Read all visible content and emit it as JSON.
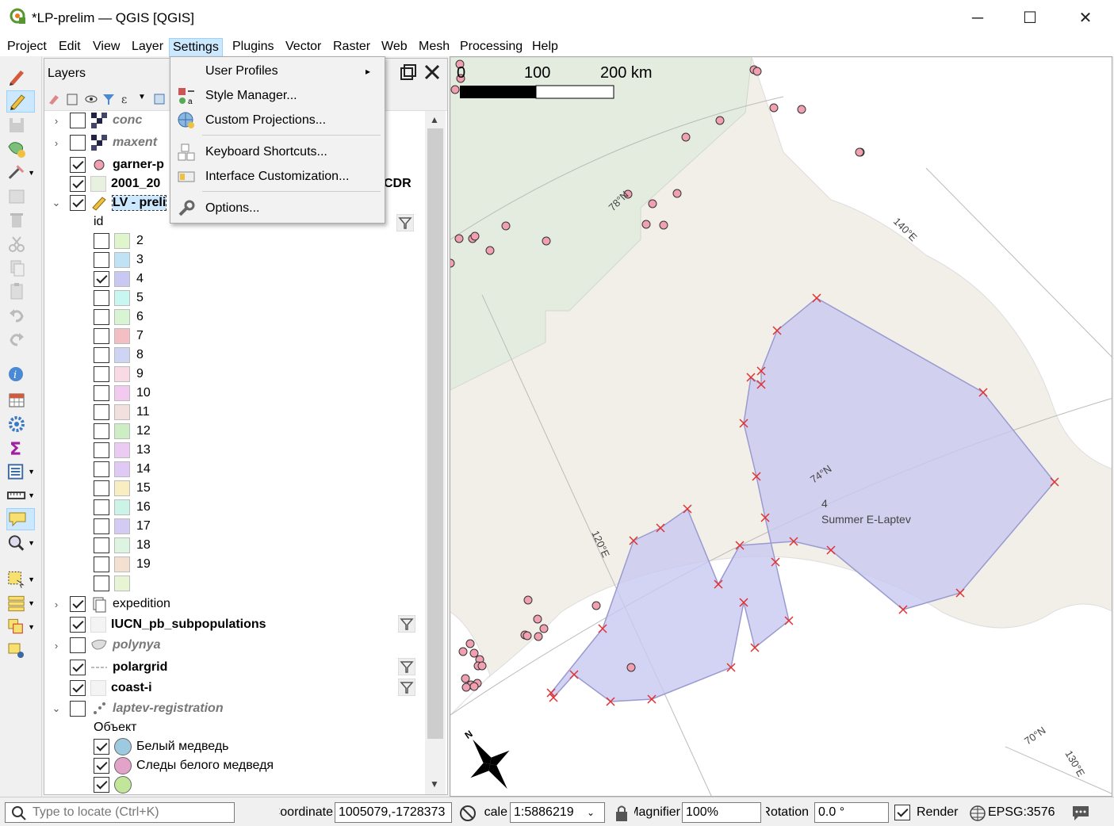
{
  "window": {
    "title": "*LP-prelim — QGIS [QGIS]",
    "minimize": "─",
    "maximize": "☐",
    "close": "✕"
  },
  "menu": [
    "Project",
    "Edit",
    "View",
    "Layer",
    "Settings",
    "Plugins",
    "Vector",
    "Raster",
    "Web",
    "Mesh",
    "Processing",
    "Help"
  ],
  "settings_menu": {
    "items": [
      "User Profiles",
      "Style Manager...",
      "Custom Projections...",
      "Keyboard Shortcuts...",
      "Interface Customization...",
      "Options..."
    ],
    "submenu_arrow": "▸"
  },
  "layers_panel": {
    "title": "Layers",
    "layers": [
      {
        "name": "conc",
        "checked": false,
        "style": "italic"
      },
      {
        "name": "maxent",
        "checked": false,
        "style": "italic"
      },
      {
        "name": "garner-p",
        "checked": true,
        "style": "bold"
      },
      {
        "name": "2001_20",
        "suffix": "CDR",
        "checked": true,
        "style": "bold"
      },
      {
        "name": "LV - preli",
        "checked": true,
        "style": "bold",
        "selected": true
      }
    ],
    "field_label": "id",
    "classes": [
      {
        "label": "2",
        "checked": false,
        "color": "#dff5cc"
      },
      {
        "label": "3",
        "checked": false,
        "color": "#bfe3f5"
      },
      {
        "label": "4",
        "checked": true,
        "color": "#c9c8f2"
      },
      {
        "label": "5",
        "checked": false,
        "color": "#c8f7f2"
      },
      {
        "label": "6",
        "checked": false,
        "color": "#d7f4d3"
      },
      {
        "label": "7",
        "checked": false,
        "color": "#f4bfc4"
      },
      {
        "label": "8",
        "checked": false,
        "color": "#cdd4f4"
      },
      {
        "label": "9",
        "checked": false,
        "color": "#f8d9e4"
      },
      {
        "label": "10",
        "checked": false,
        "color": "#f2c9ef"
      },
      {
        "label": "11",
        "checked": false,
        "color": "#f2e0dd"
      },
      {
        "label": "12",
        "checked": false,
        "color": "#cdedc4"
      },
      {
        "label": "13",
        "checked": false,
        "color": "#ebcbf2"
      },
      {
        "label": "14",
        "checked": false,
        "color": "#e0c9f4"
      },
      {
        "label": "15",
        "checked": false,
        "color": "#f8eec2"
      },
      {
        "label": "16",
        "checked": false,
        "color": "#cbf4e6"
      },
      {
        "label": "17",
        "checked": false,
        "color": "#d4cbf4"
      },
      {
        "label": "18",
        "checked": false,
        "color": "#dcf4e0"
      },
      {
        "label": "19",
        "checked": false,
        "color": "#f4e0d0"
      },
      {
        "label": "",
        "checked": false,
        "color": "#e8f5d4"
      }
    ],
    "lower_layers": [
      {
        "name": "expedition",
        "checked": true,
        "style": "normal"
      },
      {
        "name": "IUCN_pb_subpopulations",
        "checked": true,
        "style": "bold"
      },
      {
        "name": "polynya",
        "checked": false,
        "style": "italic"
      },
      {
        "name": "polargrid",
        "checked": true,
        "style": "bold"
      },
      {
        "name": "coast-i",
        "checked": true,
        "style": "bold"
      },
      {
        "name": "laptev-registration",
        "checked": false,
        "style": "italic"
      }
    ],
    "laptev_field": "Объект",
    "laptev_classes": [
      {
        "label": "Белый медведь",
        "checked": true,
        "color": "#9ecae1"
      },
      {
        "label": "Следы белого медведя",
        "checked": true,
        "color": "#e3a3c9"
      },
      {
        "label": "",
        "checked": true,
        "color": "#c2e699"
      }
    ]
  },
  "map": {
    "scale_labels": [
      "0",
      "100",
      "200 km"
    ],
    "grid_labels": [
      "78°N",
      "140°E",
      "74°N",
      "120°E",
      "70°N",
      "130°E"
    ],
    "polygon_id": "4",
    "polygon_name": "Summer E-Laptev",
    "north_arrow": "N",
    "colors": {
      "polygon": "#c8c8f0",
      "vertex": "#e03030",
      "point": "#f0a0b0",
      "green_area": "#e3ecdf",
      "land": "#ffffff",
      "sea": "#f2efe9"
    }
  },
  "statusbar": {
    "locate_placeholder": "Type to locate (Ctrl+K)",
    "coordinate_label": "Coordinate",
    "coordinate_value": "1005079,-1728373",
    "scale_label": "Scale",
    "scale_value": "1:5886219",
    "magnifier_label": "Magnifier",
    "magnifier_value": "100%",
    "rotation_label": "Rotation",
    "rotation_value": "0.0 °",
    "render_label": "Render",
    "crs": "EPSG:3576"
  }
}
